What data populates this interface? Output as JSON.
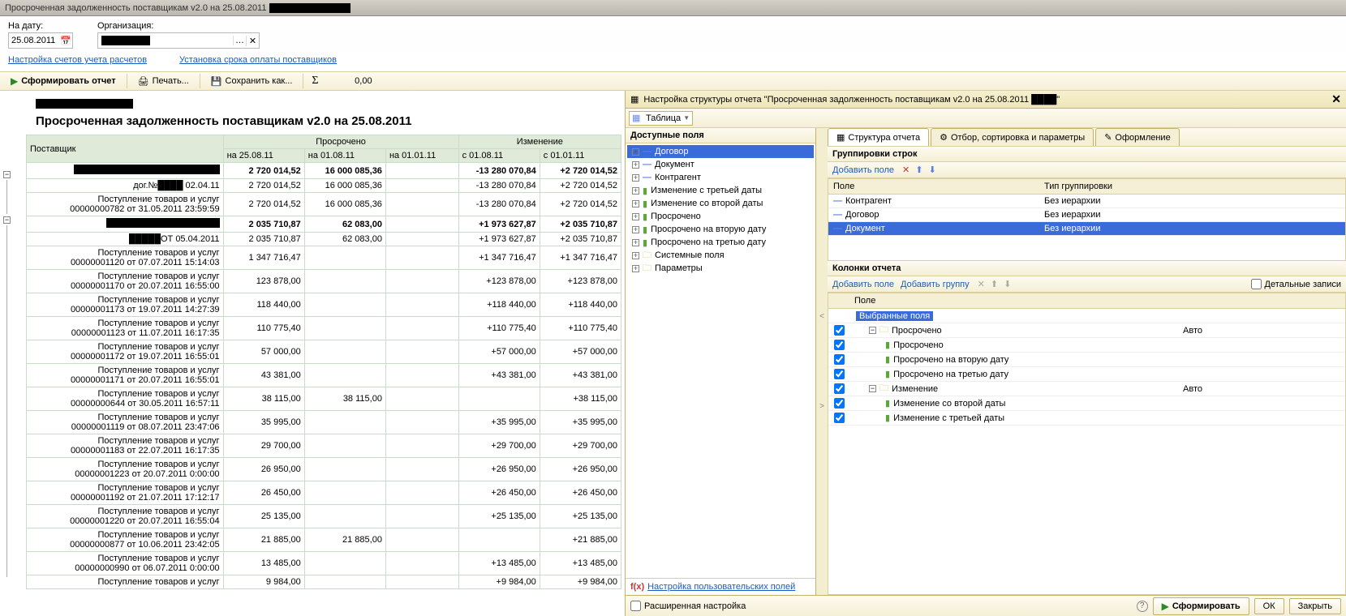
{
  "window": {
    "title": "Просроченная задолженность поставщикам v2.0 на 25.08.2011"
  },
  "params": {
    "date_label": "На дату:",
    "date_value": "25.08.2011",
    "org_label": "Организация:"
  },
  "links": {
    "accounts": "Настройка счетов учета расчетов",
    "terms": "Установка срока оплаты поставщиков"
  },
  "toolbar": {
    "generate": "Сформировать отчет",
    "print": "Печать...",
    "save": "Сохранить как...",
    "sum": "0,00"
  },
  "report": {
    "title": "Просроченная задолженность поставщикам v2.0 на 25.08.2011",
    "headers": {
      "supplier": "Поставщик",
      "overdue": "Просрочено",
      "change": "Изменение",
      "d1": "на 25.08.11",
      "d2": "на 01.08.11",
      "d3": "на 01.01.11",
      "c1": "с 01.08.11",
      "c2": "с 01.01.11"
    },
    "rows": [
      {
        "type": "bold",
        "l": "",
        "v": [
          "2 720 014,52",
          "16 000 085,36",
          "",
          "-13 280 070,84",
          "+2 720 014,52"
        ],
        "redact": 180
      },
      {
        "type": "sub",
        "l": "дог.№████ 02.04.11",
        "v": [
          "2 720 014,52",
          "16 000 085,36",
          "",
          "-13 280 070,84",
          "+2 720 014,52"
        ]
      },
      {
        "type": "doc",
        "l": "Поступление товаров и услуг 00000000782 от 31.05.2011 23:59:59",
        "v": [
          "2 720 014,52",
          "16 000 085,36",
          "",
          "-13 280 070,84",
          "+2 720 014,52"
        ]
      },
      {
        "type": "bold",
        "l": "",
        "v": [
          "2 035 710,87",
          "62 083,00",
          "",
          "+1 973 627,87",
          "+2 035 710,87"
        ],
        "redact": 140
      },
      {
        "type": "sub",
        "l": "█████ОТ 05.04.2011",
        "v": [
          "2 035 710,87",
          "62 083,00",
          "",
          "+1 973 627,87",
          "+2 035 710,87"
        ]
      },
      {
        "type": "doc",
        "l": "Поступление товаров и услуг 00000001120 от 07.07.2011 15:14:03",
        "v": [
          "1 347 716,47",
          "",
          "",
          "+1 347 716,47",
          "+1 347 716,47"
        ]
      },
      {
        "type": "doc",
        "l": "Поступление товаров и услуг 00000001170 от 20.07.2011 16:55:00",
        "v": [
          "123 878,00",
          "",
          "",
          "+123 878,00",
          "+123 878,00"
        ]
      },
      {
        "type": "doc",
        "l": "Поступление товаров и услуг 00000001173 от 19.07.2011 14:27:39",
        "v": [
          "118 440,00",
          "",
          "",
          "+118 440,00",
          "+118 440,00"
        ]
      },
      {
        "type": "doc",
        "l": "Поступление товаров и услуг 00000001123 от 11.07.2011 16:17:35",
        "v": [
          "110 775,40",
          "",
          "",
          "+110 775,40",
          "+110 775,40"
        ]
      },
      {
        "type": "doc",
        "l": "Поступление товаров и услуг 00000001172 от 19.07.2011 16:55:01",
        "v": [
          "57 000,00",
          "",
          "",
          "+57 000,00",
          "+57 000,00"
        ]
      },
      {
        "type": "doc",
        "l": "Поступление товаров и услуг 00000001171 от 20.07.2011 16:55:01",
        "v": [
          "43 381,00",
          "",
          "",
          "+43 381,00",
          "+43 381,00"
        ]
      },
      {
        "type": "doc",
        "l": "Поступление товаров и услуг 00000000644 от 30.05.2011 16:57:11",
        "v": [
          "38 115,00",
          "38 115,00",
          "",
          "",
          "+38 115,00"
        ]
      },
      {
        "type": "doc",
        "l": "Поступление товаров и услуг 00000001119 от 08.07.2011 23:47:06",
        "v": [
          "35 995,00",
          "",
          "",
          "+35 995,00",
          "+35 995,00"
        ]
      },
      {
        "type": "doc",
        "l": "Поступление товаров и услуг 00000001183 от 22.07.2011 16:17:35",
        "v": [
          "29 700,00",
          "",
          "",
          "+29 700,00",
          "+29 700,00"
        ]
      },
      {
        "type": "doc",
        "l": "Поступление товаров и услуг 00000001223 от 20.07.2011 0:00:00",
        "v": [
          "26 950,00",
          "",
          "",
          "+26 950,00",
          "+26 950,00"
        ]
      },
      {
        "type": "doc",
        "l": "Поступление товаров и услуг 00000001192 от 21.07.2011 17:12:17",
        "v": [
          "26 450,00",
          "",
          "",
          "+26 450,00",
          "+26 450,00"
        ]
      },
      {
        "type": "doc",
        "l": "Поступление товаров и услуг 00000001220 от 20.07.2011 16:55:04",
        "v": [
          "25 135,00",
          "",
          "",
          "+25 135,00",
          "+25 135,00"
        ]
      },
      {
        "type": "doc",
        "l": "Поступление товаров и услуг 00000000877 от 10.06.2011 23:42:05",
        "v": [
          "21 885,00",
          "21 885,00",
          "",
          "",
          "+21 885,00"
        ]
      },
      {
        "type": "doc",
        "l": "Поступление товаров и услуг 00000000990 от 06.07.2011 0:00:00",
        "v": [
          "13 485,00",
          "",
          "",
          "+13 485,00",
          "+13 485,00"
        ]
      },
      {
        "type": "doc",
        "l": "Поступление товаров и услуг",
        "v": [
          "9 984,00",
          "",
          "",
          "+9 984,00",
          "+9 984,00"
        ]
      }
    ]
  },
  "designer": {
    "title": "Настройка структуры отчета \"Просроченная задолженность поставщикам v2.0 на 25.08.2011 ████\"",
    "table_dd": "Таблица",
    "avail_hdr": "Доступные поля",
    "avail": [
      {
        "ic": "dash",
        "l": "Договор",
        "sel": true,
        "exp": true
      },
      {
        "ic": "dash",
        "l": "Документ",
        "exp": true
      },
      {
        "ic": "dash",
        "l": "Контрагент",
        "exp": true
      },
      {
        "ic": "grn",
        "l": "Изменение с третьей даты",
        "exp": true
      },
      {
        "ic": "grn",
        "l": "Изменение со второй даты",
        "exp": true
      },
      {
        "ic": "grn",
        "l": "Просрочено",
        "exp": true
      },
      {
        "ic": "grn",
        "l": "Просрочено на вторую дату",
        "exp": true
      },
      {
        "ic": "grn",
        "l": "Просрочено на третью дату",
        "exp": true
      },
      {
        "ic": "fld",
        "l": "Системные поля",
        "exp": true
      },
      {
        "ic": "fld",
        "l": "Параметры",
        "exp": true
      }
    ],
    "avail_foot": "Настройка пользовательских полей",
    "tabs": [
      {
        "l": "Структура отчета",
        "ic": "▦",
        "active": true
      },
      {
        "l": "Отбор, сортировка и параметры",
        "ic": "⚙"
      },
      {
        "l": "Оформление",
        "ic": "✎"
      }
    ],
    "rows_hdr": "Группировки строк",
    "rows_tb": {
      "add": "Добавить поле"
    },
    "rows_cols": {
      "field": "Поле",
      "type": "Тип группировки"
    },
    "rows": [
      {
        "ic": "dash",
        "l": "Контрагент",
        "t": "Без иерархии"
      },
      {
        "ic": "dash",
        "l": "Договор",
        "t": "Без иерархии"
      },
      {
        "ic": "dash",
        "l": "Документ",
        "t": "Без иерархии",
        "sel": true
      }
    ],
    "cols_hdr": "Колонки отчета",
    "cols_tb": {
      "add_field": "Добавить поле",
      "add_group": "Добавить группу",
      "detail": "Детальные записи"
    },
    "cols_h": "Поле",
    "cols": [
      {
        "lvl": 0,
        "ic": "sel",
        "l": "Выбранные поля",
        "sel": true,
        "chk": false
      },
      {
        "lvl": 1,
        "ic": "fld",
        "l": "Просрочено",
        "t": "Авто",
        "chk": true,
        "exp": true
      },
      {
        "lvl": 2,
        "ic": "grn",
        "l": "Просрочено",
        "chk": true
      },
      {
        "lvl": 2,
        "ic": "grn",
        "l": "Просрочено на вторую дату",
        "chk": true
      },
      {
        "lvl": 2,
        "ic": "grn",
        "l": "Просрочено на третью дату",
        "chk": true
      },
      {
        "lvl": 1,
        "ic": "fld",
        "l": "Изменение",
        "t": "Авто",
        "chk": true,
        "exp": true
      },
      {
        "lvl": 2,
        "ic": "grn",
        "l": "Изменение со второй даты",
        "chk": true
      },
      {
        "lvl": 2,
        "ic": "grn",
        "l": "Изменение с третьей даты",
        "chk": true
      }
    ],
    "footer": {
      "ext": "Расширенная настройка",
      "generate": "Сформировать",
      "ok": "ОК",
      "close": "Закрыть"
    }
  }
}
